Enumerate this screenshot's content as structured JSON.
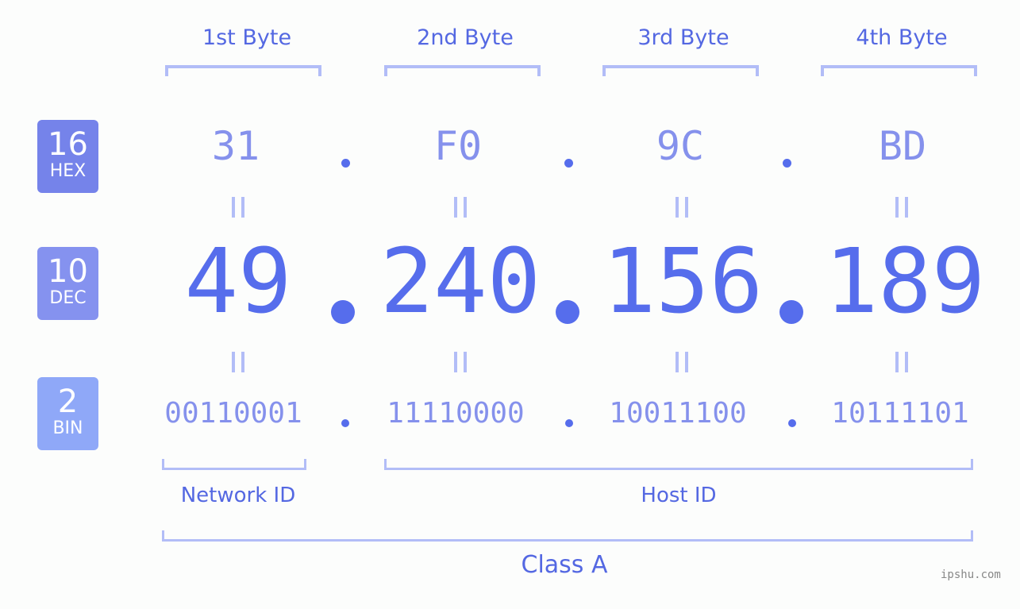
{
  "bytes": {
    "labels": [
      "1st Byte",
      "2nd Byte",
      "3rd Byte",
      "4th Byte"
    ],
    "hex": [
      "31",
      "F0",
      "9C",
      "BD"
    ],
    "dec": [
      "49",
      "240",
      "156",
      "189"
    ],
    "bin": [
      "00110001",
      "11110000",
      "10011100",
      "10111101"
    ]
  },
  "badges": {
    "hex": {
      "num": "16",
      "label": "HEX",
      "color": "#7583ea"
    },
    "dec": {
      "num": "10",
      "label": "DEC",
      "color": "#8592ef"
    },
    "bin": {
      "num": "2",
      "label": "BIN",
      "color": "#8fa8f8"
    }
  },
  "separator": ".",
  "segments": {
    "network": "Network ID",
    "host": "Host ID",
    "class": "Class A"
  },
  "watermark": "ipshu.com",
  "colors": {
    "primary": "#566dec",
    "light": "#8591ec",
    "bracket": "#b2bdf7"
  }
}
